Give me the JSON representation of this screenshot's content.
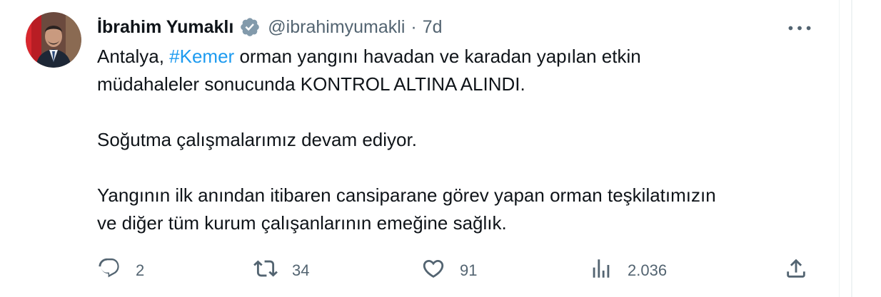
{
  "tweet": {
    "author_name": "İbrahim Yumaklı",
    "handle": "@ibrahimyumakli",
    "separator": "·",
    "time": "7d",
    "text": {
      "line1_before": "Antalya, ",
      "hashtag": "#Kemer",
      "line1_after": " orman yangını havadan ve karadan yapılan etkin",
      "line2": "müdahaleler sonucunda KONTROL ALTINA ALINDI.",
      "para2": "Soğutma çalışmalarımız devam ediyor.",
      "para3_line1": "Yangının ilk anından itibaren cansiparane görev yapan orman teşkilatımızın",
      "para3_line2": "ve diğer tüm kurum çalışanlarının emeğine sağlık."
    },
    "metrics": {
      "replies": "2",
      "retweets": "34",
      "likes": "91",
      "views": "2.036"
    }
  },
  "colors": {
    "text": "#0f1419",
    "secondary": "#536471",
    "accent": "#1d9bf0",
    "verified_badge": "#829aab"
  },
  "icons": {
    "verified": "verified-badge-icon",
    "more": "more-options-icon",
    "reply": "reply-icon",
    "retweet": "retweet-icon",
    "like": "heart-icon",
    "views": "views-chart-icon",
    "share": "share-icon"
  }
}
